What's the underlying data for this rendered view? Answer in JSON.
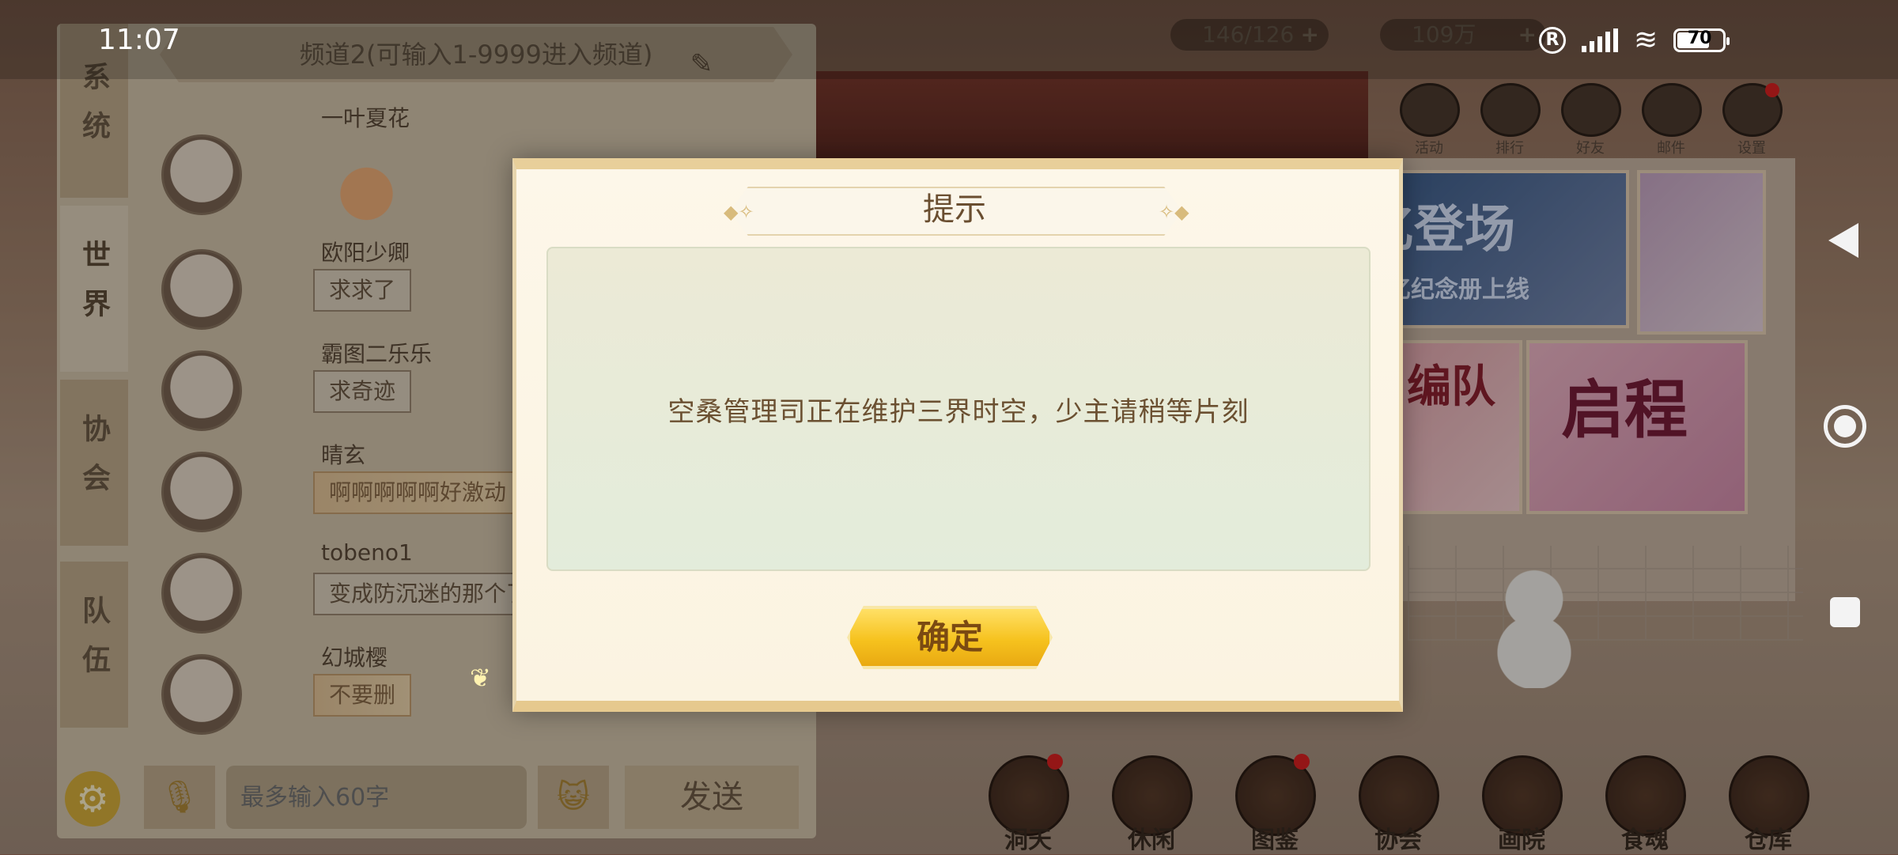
{
  "status_bar": {
    "time": "11:07",
    "battery": "70",
    "registered_mark": "R"
  },
  "game_hud": {
    "resource_1": "146/126",
    "resource_2": "109万",
    "top_icons": [
      {
        "label": "活动",
        "icon": "gift-icon",
        "badge": false
      },
      {
        "label": "排行",
        "icon": "ranking-icon",
        "badge": false
      },
      {
        "label": "好友",
        "icon": "friends-icon",
        "badge": false
      },
      {
        "label": "邮件",
        "icon": "mail-icon",
        "badge": false
      },
      {
        "label": "设置",
        "icon": "settings-icon",
        "badge": true
      }
    ],
    "banners": {
      "banner_1_title": "忆登场",
      "banner_1_sub": "绘忆纪念册上线",
      "banner_3_title": "编队",
      "banner_4_title": "启程"
    },
    "bottom_nav": [
      {
        "label": "洞天",
        "badge": true
      },
      {
        "label": "休闲",
        "badge": false
      },
      {
        "label": "图鉴",
        "badge": true
      },
      {
        "label": "协会",
        "badge": false
      },
      {
        "label": "画院",
        "badge": false
      },
      {
        "label": "食魂",
        "badge": false
      },
      {
        "label": "仓库",
        "badge": false
      }
    ]
  },
  "chat": {
    "tabs": [
      "系统",
      "世界",
      "协会",
      "队伍"
    ],
    "active_tab": "世界",
    "channel_text": "频道2(可输入1-9999进入频道)",
    "messages": [
      {
        "name": "一叶夏花",
        "text": "",
        "type": "sticker"
      },
      {
        "name": "欧阳少卿",
        "text": "求求了",
        "type": "plain"
      },
      {
        "name": "霸图二乐乐",
        "text": "求奇迹",
        "type": "plain"
      },
      {
        "name": "晴玄",
        "text": "啊啊啊啊啊好激动",
        "type": "fancy"
      },
      {
        "name": "tobeno1",
        "text": "变成防沉迷的那个了",
        "type": "plain"
      },
      {
        "name": "幻城樱",
        "text": "不要删",
        "type": "fancy"
      }
    ],
    "input_placeholder": "最多输入60字",
    "send_label": "发送"
  },
  "dialog": {
    "title": "提示",
    "message": "空桑管理司正在维护三界时空，少主请稍等片刻",
    "confirm_label": "确定"
  },
  "colors": {
    "dialog_bg": "#fdf7e9",
    "dialog_body": "#e6ebd8",
    "confirm_btn": "#f6c21e",
    "title_text": "#6a4e30"
  }
}
